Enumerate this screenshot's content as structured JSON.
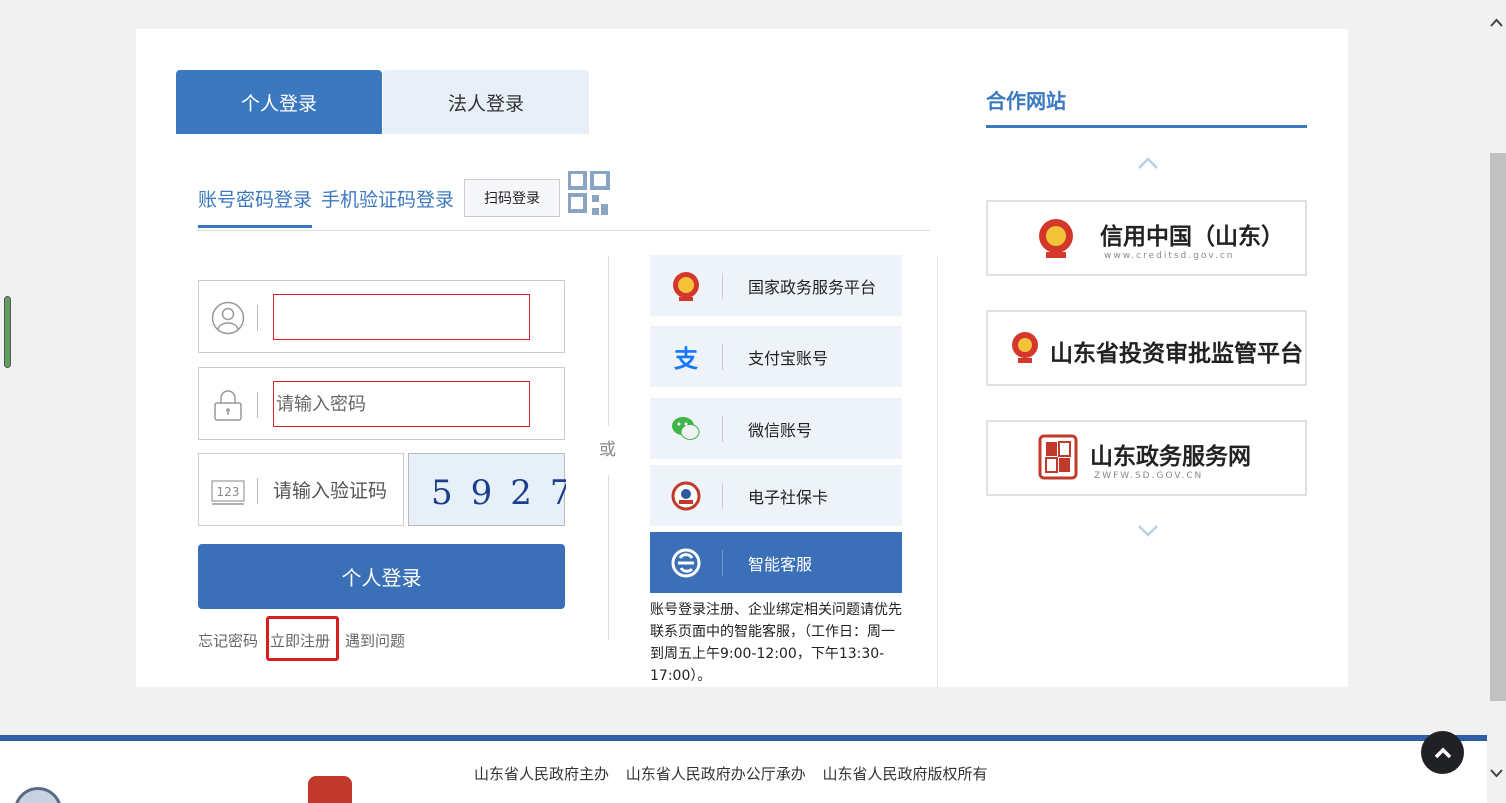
{
  "tabs": {
    "personal": "个人登录",
    "legal": "法人登录"
  },
  "subtabs": {
    "account": "账号密码登录",
    "phone": "手机验证码登录",
    "scan": "扫码登录"
  },
  "form": {
    "username_value": "",
    "password_placeholder": "请输入密码",
    "code_placeholder": "请输入验证码",
    "code_icon_text": "123",
    "captcha": "5927",
    "login_button": "个人登录"
  },
  "links": {
    "forgot": "忘记密码",
    "register": "立即注册",
    "problem": "遇到问题"
  },
  "or_text": "或",
  "third_party": [
    {
      "label": "国家政务服务平台",
      "icon": "national-emblem-icon"
    },
    {
      "label": "支付宝账号",
      "icon": "alipay-icon"
    },
    {
      "label": "微信账号",
      "icon": "wechat-icon"
    },
    {
      "label": "电子社保卡",
      "icon": "social-security-card-icon"
    },
    {
      "label": "智能客服",
      "icon": "customer-service-icon"
    }
  ],
  "service_note": "账号登录注册、企业绑定相关问题请优先联系页面中的智能客服，（工作日：周一到周五上午9:00-12:00，下午13:30-17:00）。",
  "partners": {
    "title": "合作网站",
    "sites": [
      {
        "name": "信用中国（山东）",
        "sub": "www.creditsd.gov.cn"
      },
      {
        "name": "山东省投资审批监管平台",
        "sub": ""
      },
      {
        "name": "山东政务服务网",
        "sub": "ZWFW.SD.GOV.CN"
      }
    ]
  },
  "footer": {
    "text": "山东省人民政府主办 山东省人民政府办公厅承办 山东省人民政府版权所有"
  },
  "colors": {
    "primary": "#3b78c0",
    "button": "#3b70b8",
    "highlight_red": "#d61e1e",
    "footer_bar": "#2e5fa8"
  }
}
